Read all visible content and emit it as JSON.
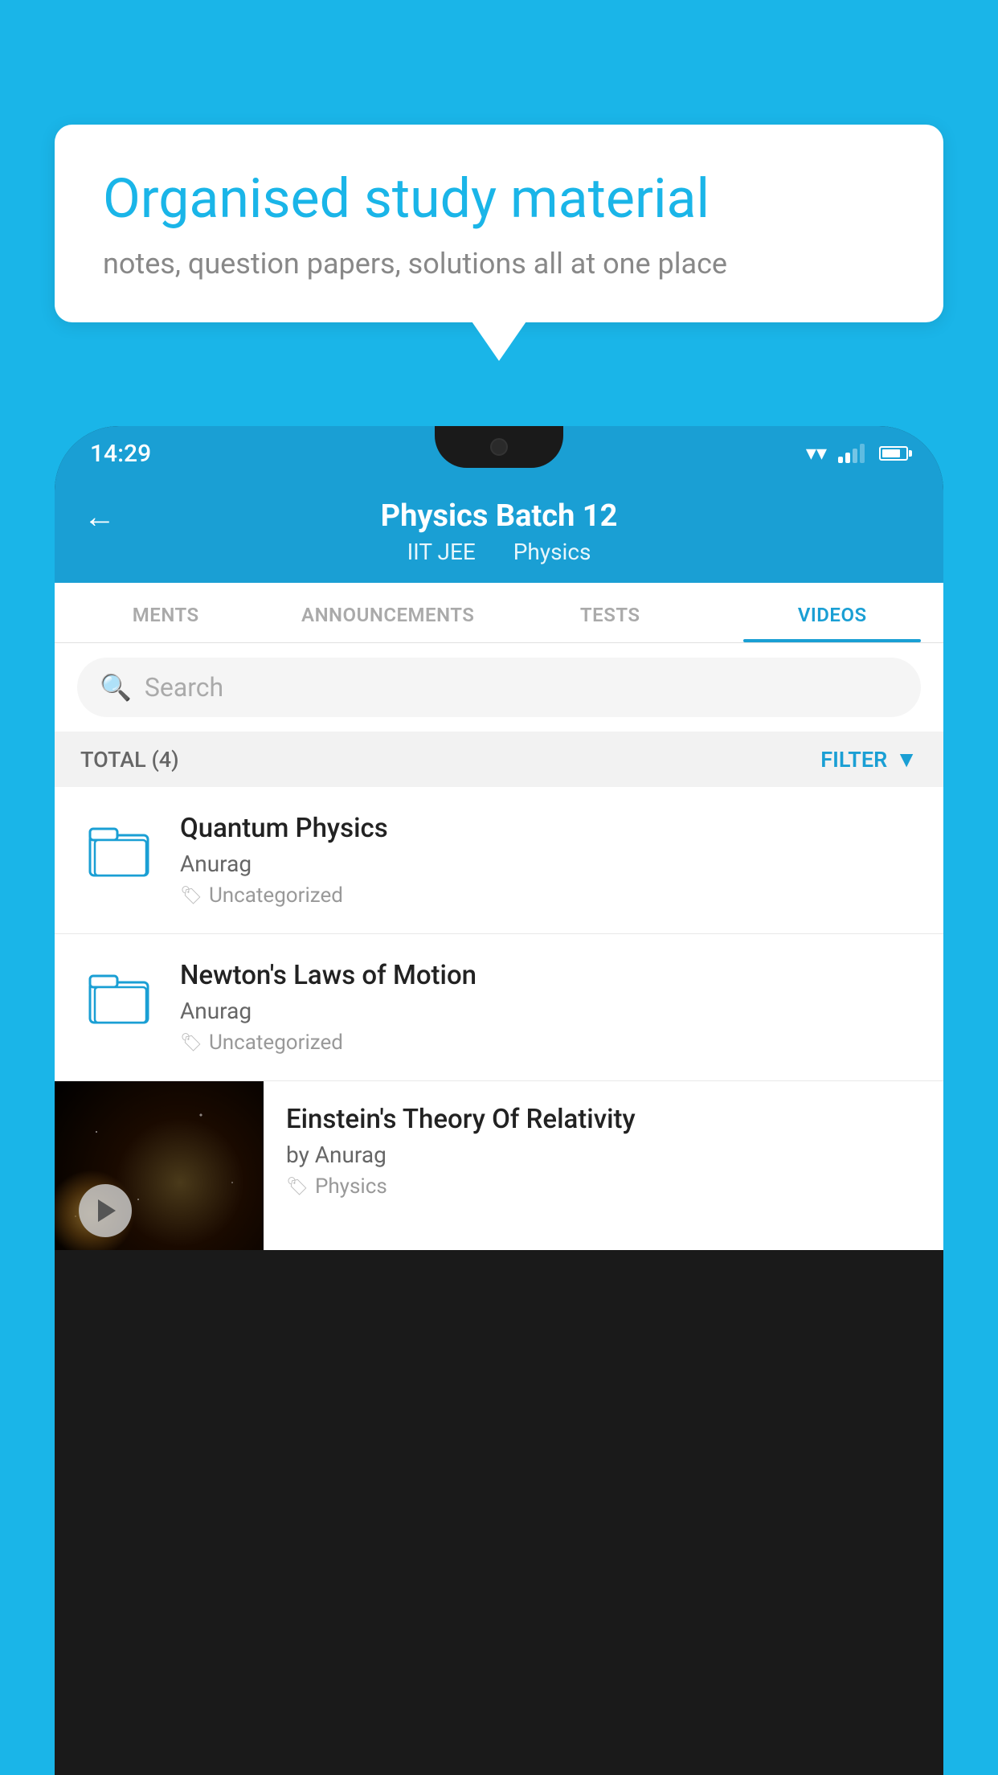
{
  "background_color": "#1ab5e8",
  "speech_bubble": {
    "title": "Organised study material",
    "subtitle": "notes, question papers, solutions all at one place"
  },
  "phone": {
    "status_bar": {
      "time": "14:29"
    },
    "app_header": {
      "title": "Physics Batch 12",
      "subtitle_part1": "IIT JEE",
      "subtitle_part2": "Physics",
      "back_label": "←"
    },
    "tabs": [
      {
        "label": "MENTS",
        "active": false
      },
      {
        "label": "ANNOUNCEMENTS",
        "active": false
      },
      {
        "label": "TESTS",
        "active": false
      },
      {
        "label": "VIDEOS",
        "active": true
      }
    ],
    "search": {
      "placeholder": "Search"
    },
    "filter_bar": {
      "total_label": "TOTAL (4)",
      "filter_label": "FILTER"
    },
    "videos": [
      {
        "title": "Quantum Physics",
        "author": "Anurag",
        "tag": "Uncategorized",
        "has_thumbnail": false
      },
      {
        "title": "Newton's Laws of Motion",
        "author": "Anurag",
        "tag": "Uncategorized",
        "has_thumbnail": false
      },
      {
        "title": "Einstein's Theory Of Relativity",
        "author": "by Anurag",
        "tag": "Physics",
        "has_thumbnail": true
      }
    ]
  }
}
